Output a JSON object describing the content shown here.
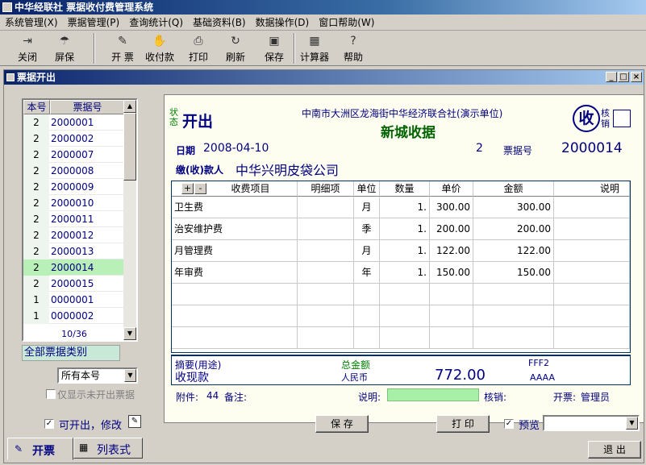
{
  "app": {
    "title": "中华经联社 票据收付费管理系统"
  },
  "menu": [
    "系统管理(X)",
    "票据管理(P)",
    "查询统计(Q)",
    "基础资料(B)",
    "数据操作(D)",
    "窗口帮助(W)"
  ],
  "toolbar": {
    "close": "关闭",
    "lock": "屏保",
    "issue": "开 票",
    "pay": "收付款",
    "print": "打印",
    "refresh": "刷新",
    "save": "保存",
    "calc": "计算器",
    "help": "帮助"
  },
  "window": {
    "title": "票据开出"
  },
  "list": {
    "headers": [
      "本号",
      "票据号"
    ],
    "rows": [
      {
        "book": "2",
        "no": "2000001"
      },
      {
        "book": "2",
        "no": "2000002"
      },
      {
        "book": "2",
        "no": "2000007"
      },
      {
        "book": "2",
        "no": "2000008"
      },
      {
        "book": "2",
        "no": "2000009"
      },
      {
        "book": "2",
        "no": "2000010"
      },
      {
        "book": "2",
        "no": "2000011"
      },
      {
        "book": "2",
        "no": "2000012"
      },
      {
        "book": "2",
        "no": "2000013"
      },
      {
        "book": "2",
        "no": "2000014"
      },
      {
        "book": "2",
        "no": "2000015"
      },
      {
        "book": "1",
        "no": "0000001"
      },
      {
        "book": "1",
        "no": "0000002"
      }
    ],
    "selected_index": 9,
    "position": "10/36"
  },
  "filters": {
    "category": "全部票据类别",
    "book": "所有本号",
    "unissued_only": "仅显示未开出票据",
    "editable": "可开出，修改"
  },
  "receipt": {
    "status_label": "状态",
    "status": "开出",
    "org": "中南市大洲区龙海街中华经济联合社(演示单位)",
    "title": "新城收据",
    "shou": "收",
    "verify_label": "核销",
    "date_label": "日期",
    "date": "2008-04-10",
    "book": "2",
    "no_label": "票据号",
    "no": "2000014",
    "payer_label": "缴(收)款人",
    "payer": "中华兴明皮袋公司"
  },
  "grid": {
    "plus": "+",
    "minus": "-",
    "headers": [
      "收费项目",
      "明细项",
      "单位",
      "数量",
      "单价",
      "金额",
      "说明"
    ],
    "rows": [
      {
        "item": "卫生费",
        "detail": "",
        "unit": "月",
        "qty": "1.",
        "price": "300.00",
        "amount": "300.00",
        "note": ""
      },
      {
        "item": "治安维护费",
        "detail": "",
        "unit": "季",
        "qty": "1.",
        "price": "200.00",
        "amount": "200.00",
        "note": ""
      },
      {
        "item": "月管理费",
        "detail": "",
        "unit": "月",
        "qty": "1.",
        "price": "122.00",
        "amount": "122.00",
        "note": ""
      },
      {
        "item": "年审费",
        "detail": "",
        "unit": "年",
        "qty": "1.",
        "price": "150.00",
        "amount": "150.00",
        "note": ""
      },
      {
        "item": "",
        "detail": "",
        "unit": "",
        "qty": "",
        "price": "",
        "amount": "",
        "note": ""
      },
      {
        "item": "",
        "detail": "",
        "unit": "",
        "qty": "",
        "price": "",
        "amount": "",
        "note": ""
      },
      {
        "item": "",
        "detail": "",
        "unit": "",
        "qty": "",
        "price": "",
        "amount": "",
        "note": ""
      }
    ]
  },
  "summary": {
    "memo_label": "摘要(用途)",
    "memo": "收现款",
    "total_label": "总金额",
    "currency": "人民币",
    "total": "772.00",
    "code1": "FFF2",
    "code2": "AAAA"
  },
  "footer": {
    "attach_label": "附件:",
    "attach": "44",
    "remark_label": "备注:",
    "desc_label": "说明:",
    "verify_label": "核销:",
    "issuer_label": "开票:",
    "issuer": "管理员"
  },
  "buttons": {
    "save": "保 存",
    "print": "打 印",
    "preview": "预览",
    "exit": "退 出"
  },
  "tabs": {
    "issue": "开票",
    "list": "列表式"
  },
  "colors": {
    "title_bar": "#0a246a",
    "selected_row": "#b8f0b8",
    "header_blue": "#000080",
    "green_title": "#006400"
  }
}
